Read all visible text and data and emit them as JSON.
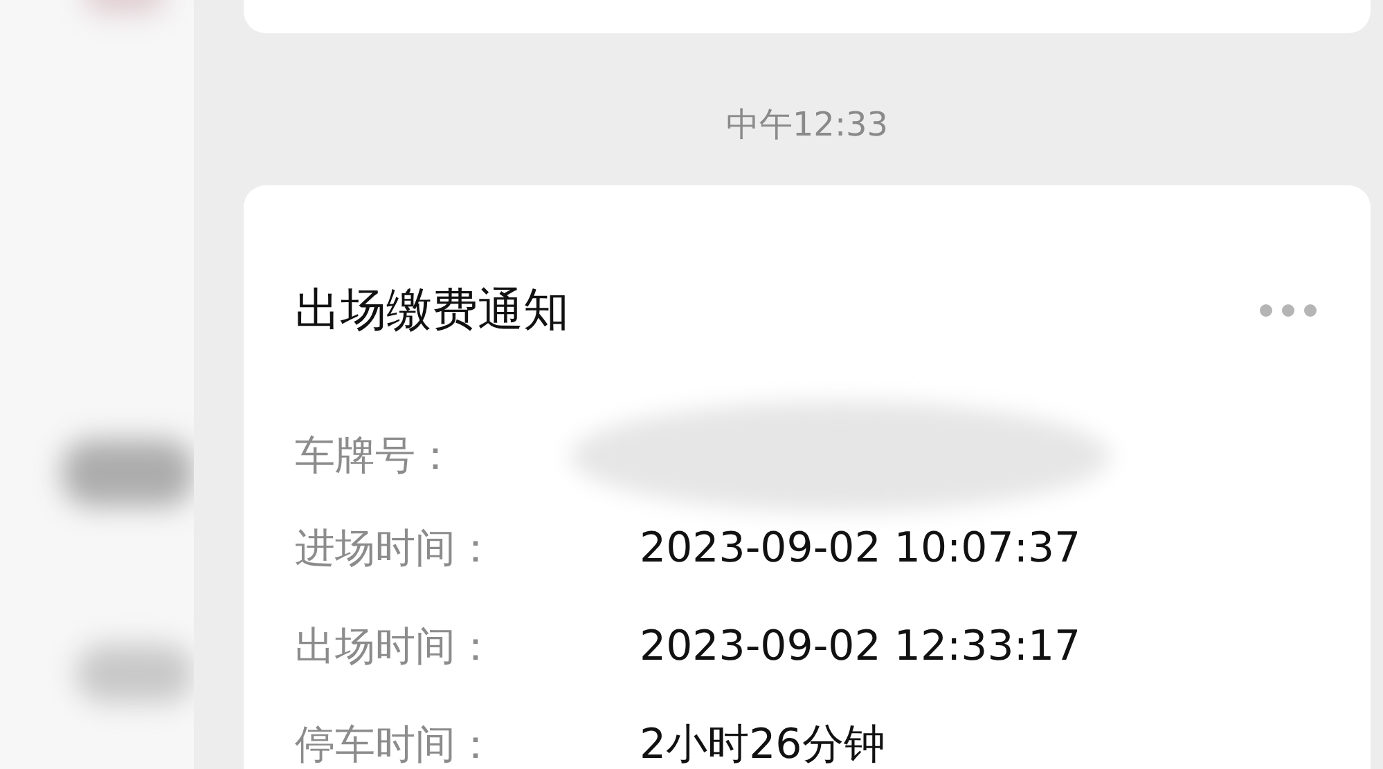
{
  "time_divider": "中午12:33",
  "card": {
    "title": "出场缴费通知",
    "fields": [
      {
        "label": "车牌号：",
        "kind": "redacted"
      },
      {
        "label": "进场时间：",
        "kind": "text",
        "value": "2023-09-02 10:07:37"
      },
      {
        "label": "出场时间：",
        "kind": "text",
        "value": "2023-09-02 12:33:17"
      },
      {
        "label": "停车时间：",
        "kind": "text",
        "value": "2小时26分钟"
      }
    ]
  }
}
